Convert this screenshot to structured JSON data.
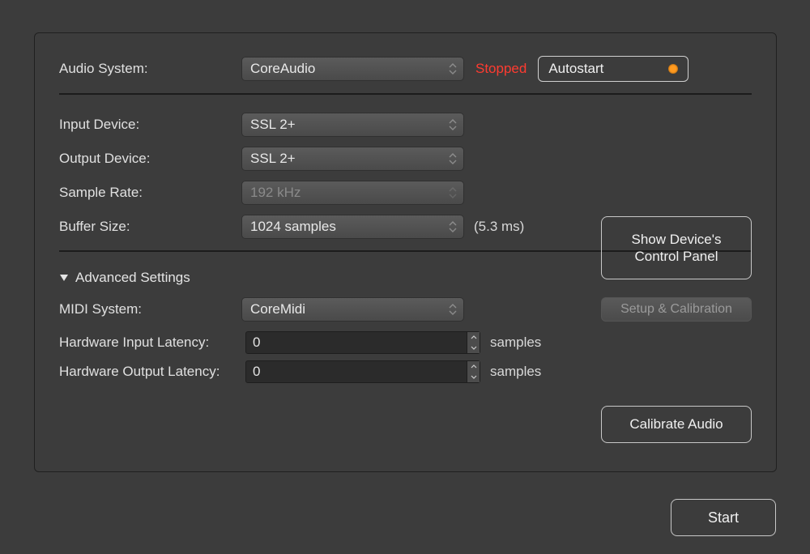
{
  "labels": {
    "audio_system": "Audio System:",
    "input_device": "Input Device:",
    "output_device": "Output Device:",
    "sample_rate": "Sample Rate:",
    "buffer_size": "Buffer Size:",
    "advanced": "Advanced Settings",
    "midi_system": "MIDI System:",
    "hw_in_latency": "Hardware Input Latency:",
    "hw_out_latency": "Hardware Output Latency:",
    "samples_suffix": "samples"
  },
  "values": {
    "audio_system": "CoreAudio",
    "input_device": "SSL 2+",
    "output_device": "SSL 2+",
    "sample_rate": "192 kHz",
    "buffer_size": "1024 samples",
    "buffer_ms": "(5.3 ms)",
    "midi_system": "CoreMidi",
    "hw_in_latency": "0",
    "hw_out_latency": "0"
  },
  "status": {
    "text": "Stopped",
    "color": "#ff3b30"
  },
  "buttons": {
    "autostart": "Autostart",
    "device_panel": "Show Device's Control Panel",
    "setup_calibration": "Setup & Calibration",
    "calibrate": "Calibrate Audio",
    "start": "Start"
  }
}
